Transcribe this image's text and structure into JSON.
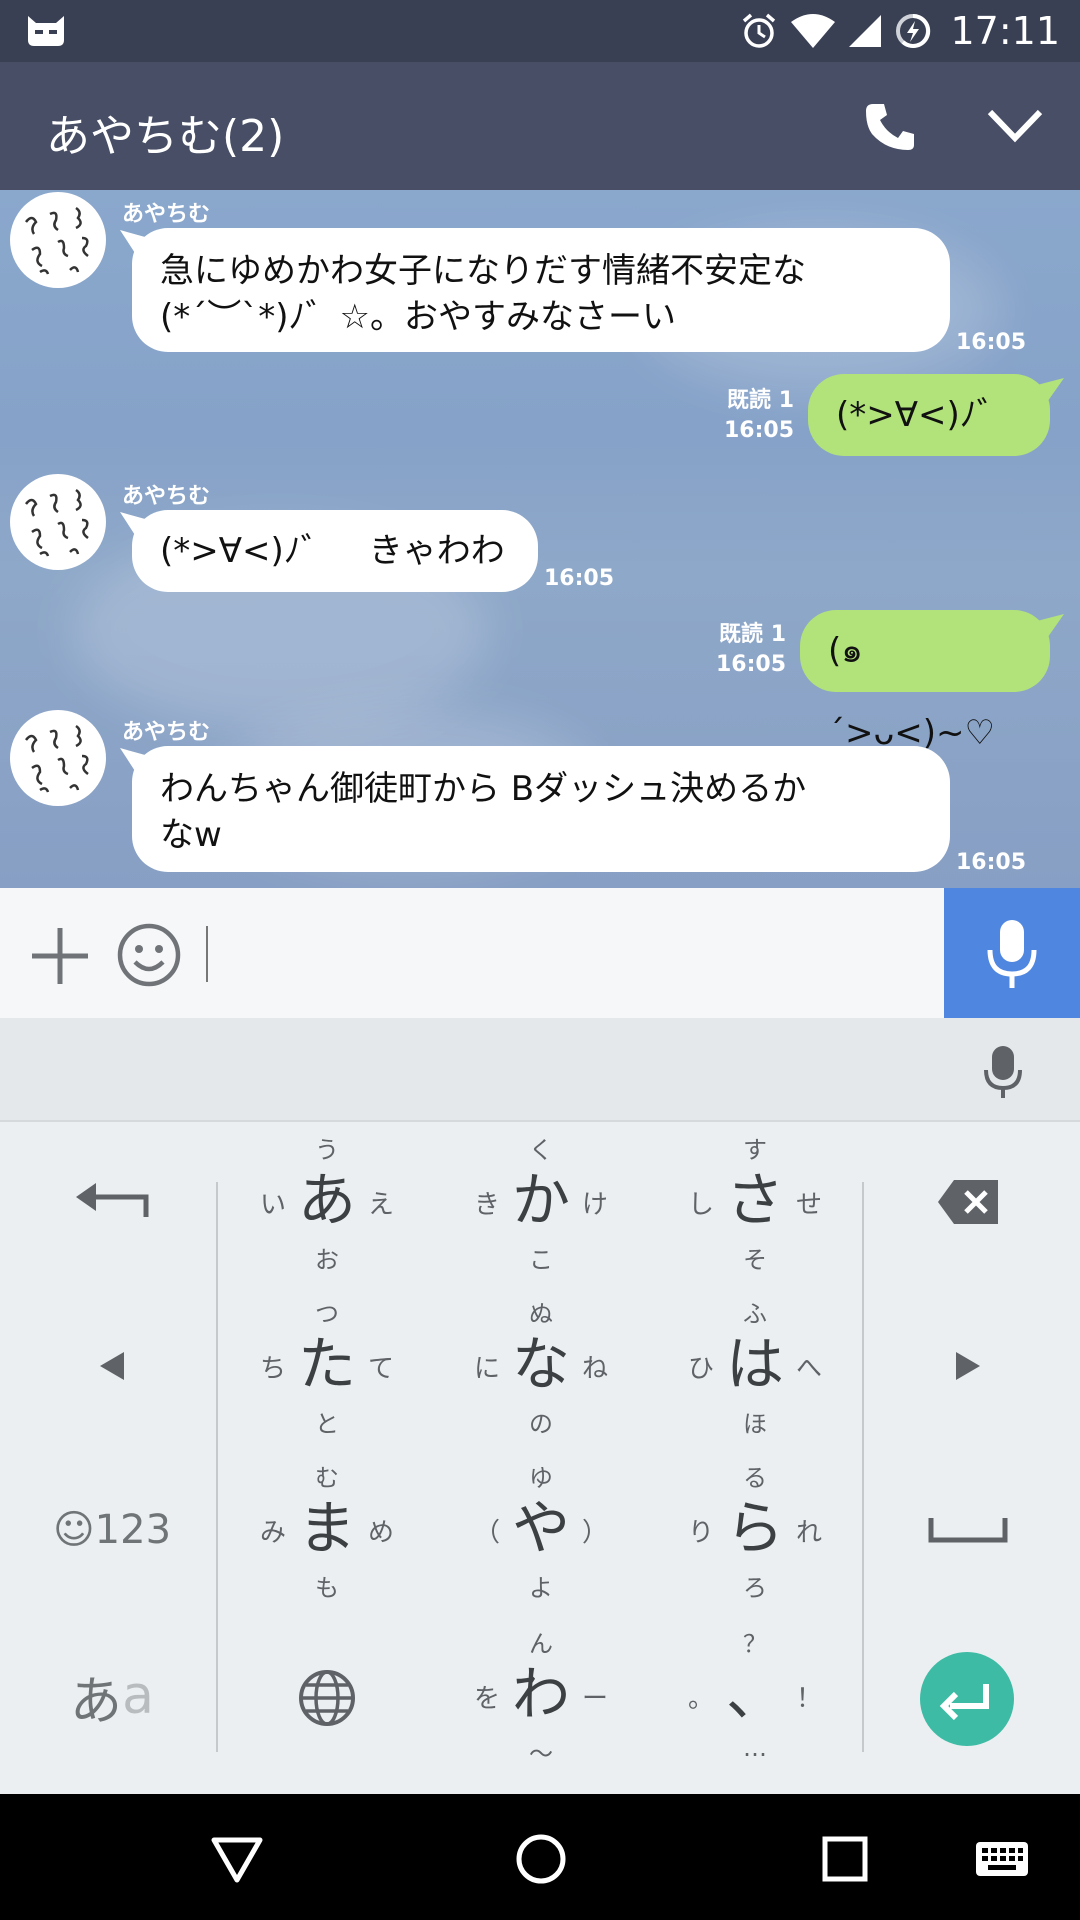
{
  "status_bar": {
    "time": "17:11",
    "icons": [
      "cyanogen-bot-icon",
      "alarm-icon",
      "wifi-icon",
      "signal-icon",
      "battery-charging-icon"
    ]
  },
  "app_bar": {
    "title": "あやちむ(2)",
    "icons": [
      "phone-icon",
      "chevron-down-icon"
    ]
  },
  "chat": {
    "messages": [
      {
        "side": "in",
        "sender": "あやちむ",
        "lines": [
          "急にゆめかわ女子になりだす情緒不安定な",
          "(*´︶`*)ﾉ゛☆。おやすみなさーい"
        ],
        "time": "16:05"
      },
      {
        "side": "out",
        "read": "既読 1",
        "text": "(*>∀<)ﾉ゛",
        "time": "16:05"
      },
      {
        "side": "in",
        "sender": "あやちむ",
        "lines": [
          "(*>∀<)ﾉ゛　きゃわわ"
        ],
        "time": "16:05"
      },
      {
        "side": "out",
        "read": "既読 1",
        "text": "(๑´>ᴗ<)~♡",
        "time": "16:05"
      },
      {
        "side": "in",
        "sender": "あやちむ",
        "lines": [
          "わんちゃん御徒町から Bダッシュ決めるか",
          "なw"
        ],
        "time": "16:05"
      }
    ]
  },
  "input_bar": {
    "value": "",
    "icons": [
      "plus-icon",
      "emoji-icon",
      "microphone-icon"
    ]
  },
  "keyboard": {
    "toolbar_icon": "microphone-icon",
    "keys": [
      {
        "main": "あ",
        "up": "う",
        "down": "お",
        "left": "い",
        "right": "え"
      },
      {
        "main": "か",
        "up": "く",
        "down": "こ",
        "left": "き",
        "right": "け"
      },
      {
        "main": "さ",
        "up": "す",
        "down": "そ",
        "left": "し",
        "right": "せ"
      },
      {
        "main": "た",
        "up": "つ",
        "down": "と",
        "left": "ち",
        "right": "て"
      },
      {
        "main": "な",
        "up": "ぬ",
        "down": "の",
        "left": "に",
        "right": "ね"
      },
      {
        "main": "は",
        "up": "ふ",
        "down": "ほ",
        "left": "ひ",
        "right": "へ"
      },
      {
        "main": "ま",
        "up": "む",
        "down": "も",
        "left": "み",
        "right": "め"
      },
      {
        "main": "や",
        "up": "ゆ",
        "down": "よ",
        "left": "（",
        "right": "）"
      },
      {
        "main": "ら",
        "up": "る",
        "down": "ろ",
        "left": "り",
        "right": "れ"
      },
      {
        "main": "わ",
        "up": "ん",
        "down": "〜",
        "left": "を",
        "right": "ー"
      },
      {
        "main": "、",
        "up": "？",
        "down": "…",
        "left": "。",
        "right": "！"
      }
    ],
    "emoji_numbers_label": "☺123",
    "kana_label_main": "あ",
    "kana_label_sub": "a",
    "side_icons": [
      "undo-icon",
      "backspace-icon",
      "cursor-left-icon",
      "cursor-right-icon",
      "space-icon",
      "globe-icon",
      "enter-icon"
    ]
  },
  "nav_bar": {
    "icons": [
      "back-icon",
      "home-icon",
      "recents-icon",
      "keyboard-switch-icon"
    ]
  }
}
